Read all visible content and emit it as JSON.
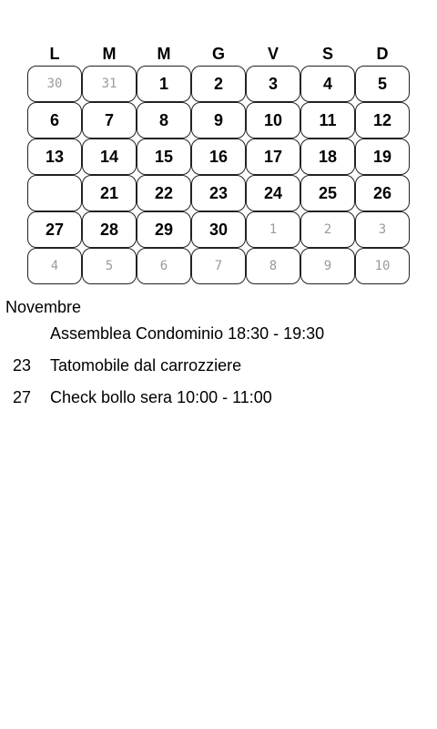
{
  "calendar": {
    "weekdays": [
      "L",
      "M",
      "M",
      "G",
      "V",
      "S",
      "D"
    ],
    "weeks": [
      [
        {
          "label": "30",
          "muted": true
        },
        {
          "label": "31",
          "muted": true
        },
        {
          "label": "1",
          "muted": false
        },
        {
          "label": "2",
          "muted": false
        },
        {
          "label": "3",
          "muted": false
        },
        {
          "label": "4",
          "muted": false
        },
        {
          "label": "5",
          "muted": false
        }
      ],
      [
        {
          "label": "6",
          "muted": false
        },
        {
          "label": "7",
          "muted": false
        },
        {
          "label": "8",
          "muted": false
        },
        {
          "label": "9",
          "muted": false
        },
        {
          "label": "10",
          "muted": false
        },
        {
          "label": "11",
          "muted": false
        },
        {
          "label": "12",
          "muted": false
        }
      ],
      [
        {
          "label": "13",
          "muted": false
        },
        {
          "label": "14",
          "muted": false
        },
        {
          "label": "15",
          "muted": false
        },
        {
          "label": "16",
          "muted": false
        },
        {
          "label": "17",
          "muted": false
        },
        {
          "label": "18",
          "muted": false
        },
        {
          "label": "19",
          "muted": false
        }
      ],
      [
        {
          "label": "",
          "muted": false
        },
        {
          "label": "21",
          "muted": false
        },
        {
          "label": "22",
          "muted": false
        },
        {
          "label": "23",
          "muted": false
        },
        {
          "label": "24",
          "muted": false
        },
        {
          "label": "25",
          "muted": false
        },
        {
          "label": "26",
          "muted": false
        }
      ],
      [
        {
          "label": "27",
          "muted": false
        },
        {
          "label": "28",
          "muted": false
        },
        {
          "label": "29",
          "muted": false
        },
        {
          "label": "30",
          "muted": false
        },
        {
          "label": "1",
          "muted": true
        },
        {
          "label": "2",
          "muted": true
        },
        {
          "label": "3",
          "muted": true
        }
      ],
      [
        {
          "label": "4",
          "muted": true
        },
        {
          "label": "5",
          "muted": true
        },
        {
          "label": "6",
          "muted": true
        },
        {
          "label": "7",
          "muted": true
        },
        {
          "label": "8",
          "muted": true
        },
        {
          "label": "9",
          "muted": true
        },
        {
          "label": "10",
          "muted": true
        }
      ]
    ]
  },
  "events": {
    "month_title": "Novembre",
    "items": [
      {
        "day": "",
        "title": "Assemblea Condominio 18:30 - 19:30"
      },
      {
        "day": "23",
        "title": "Tatomobile dal carrozziere"
      },
      {
        "day": "27",
        "title": "Check bollo sera 10:00 - 11:00"
      }
    ]
  }
}
